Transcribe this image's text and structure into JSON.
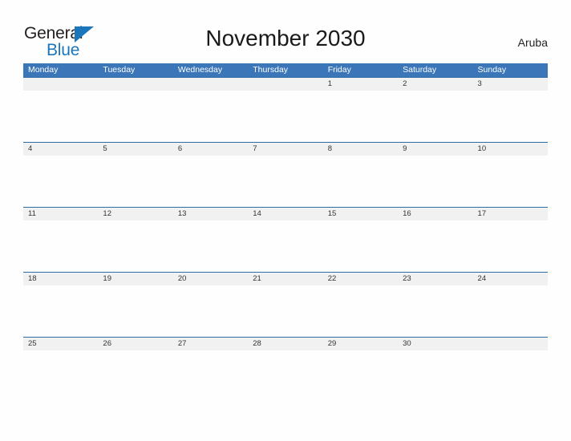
{
  "branding": {
    "logo_text_primary": "General",
    "logo_text_secondary": "Blue",
    "triangle_color": "#1b76bc",
    "primary_text_color": "#231f20"
  },
  "header": {
    "title": "November 2030",
    "region": "Aruba"
  },
  "theme": {
    "header_blue": "#3a76b8",
    "row_divider_blue": "#2e6da4",
    "date_band_gray": "#f1f1f1",
    "page_background": "#fefefe",
    "weekday_text": "#ffffff",
    "date_text": "#333333"
  },
  "calendar": {
    "weekdays": [
      "Monday",
      "Tuesday",
      "Wednesday",
      "Thursday",
      "Friday",
      "Saturday",
      "Sunday"
    ],
    "weeks": [
      [
        "",
        "",
        "",
        "",
        "1",
        "2",
        "3"
      ],
      [
        "4",
        "5",
        "6",
        "7",
        "8",
        "9",
        "10"
      ],
      [
        "11",
        "12",
        "13",
        "14",
        "15",
        "16",
        "17"
      ],
      [
        "18",
        "19",
        "20",
        "21",
        "22",
        "23",
        "24"
      ],
      [
        "25",
        "26",
        "27",
        "28",
        "29",
        "30",
        ""
      ]
    ]
  }
}
